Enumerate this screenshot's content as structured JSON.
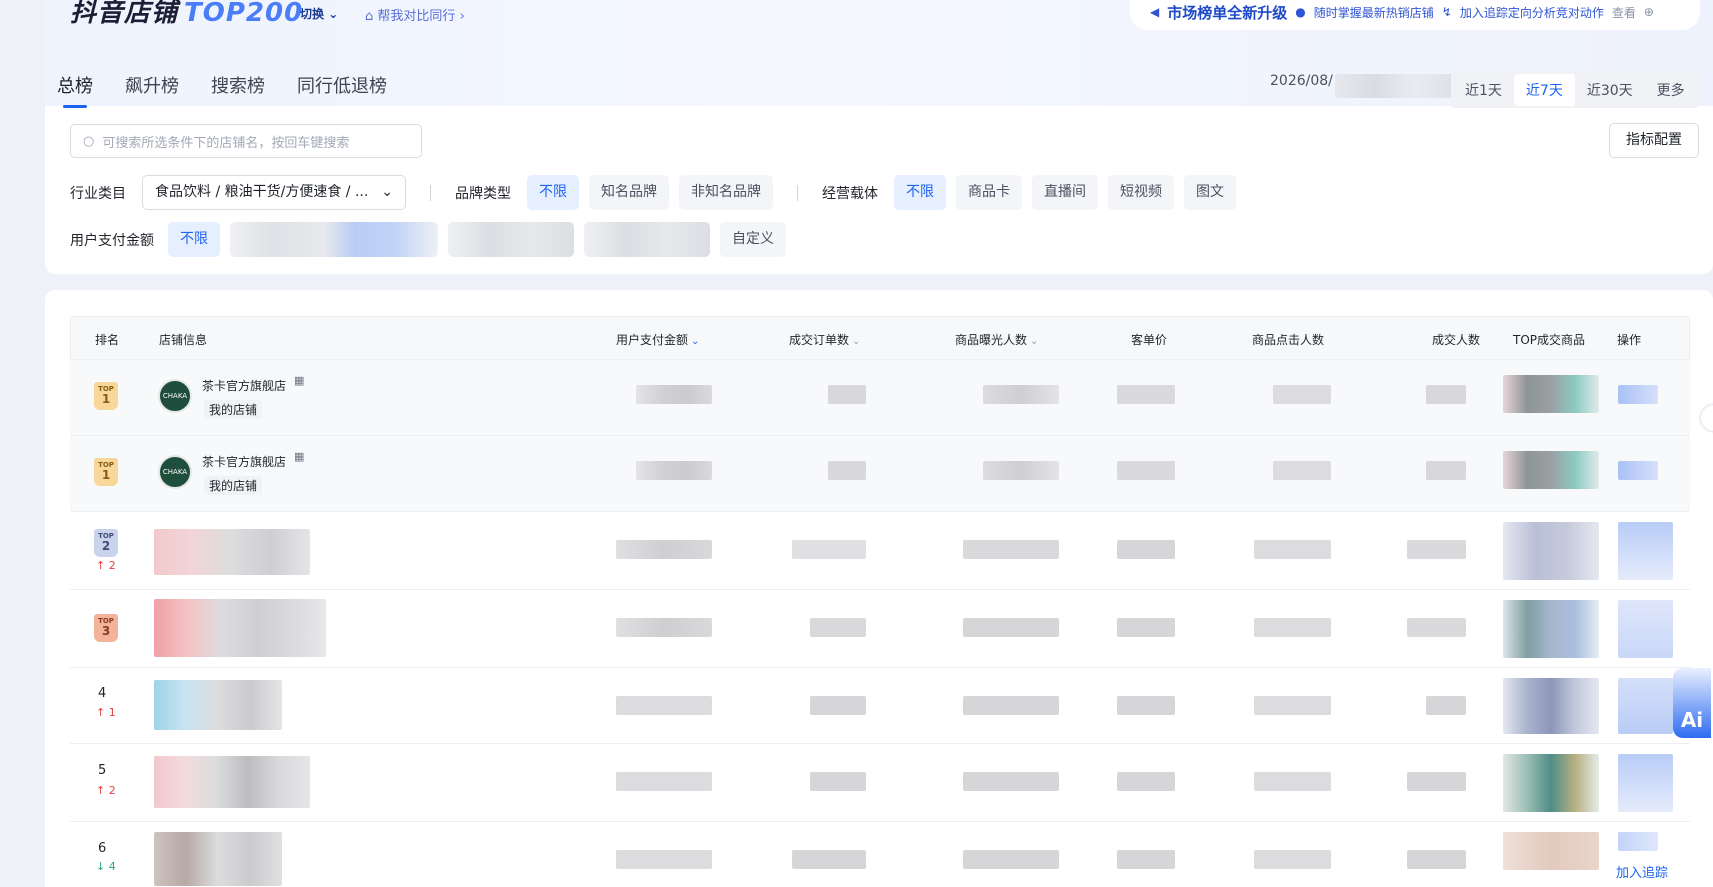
{
  "header": {
    "logo_text": "抖音店铺",
    "logo_top": "TOP200",
    "switch_label": "切换",
    "compare_label": "帮我对比同行",
    "banner_title": "市场榜单全新升级",
    "banner_text1": "随时掌握最新热销店铺",
    "banner_text2": "加入追踪定向分析竞对动作",
    "banner_link": "查看"
  },
  "tabs": [
    "总榜",
    "飙升榜",
    "搜索榜",
    "同行低退榜"
  ],
  "date": {
    "prefix": "2026/08/",
    "ranges": [
      "近1天",
      "近7天",
      "近30天",
      "更多"
    ],
    "active_range": "近7天"
  },
  "search": {
    "placeholder": "可搜索所选条件下的店铺名，按回车键搜索"
  },
  "config_button": "指标配置",
  "filters": {
    "industry_label": "行业类目",
    "industry_value": "食品饮料 / 粮油干货/方便速食 / ...",
    "brand_label": "品牌类型",
    "brand_options": [
      "不限",
      "知名品牌",
      "非知名品牌"
    ],
    "carrier_label": "经营载体",
    "carrier_options": [
      "不限",
      "商品卡",
      "直播间",
      "短视频",
      "图文"
    ],
    "pay_label": "用户支付金额",
    "pay_selected": "不限",
    "pay_custom": "自定义"
  },
  "table": {
    "columns": [
      "排名",
      "店铺信息",
      "用户支付金额",
      "成交订单数",
      "商品曝光人数",
      "客单价",
      "商品点击人数",
      "成交人数",
      "TOP成交商品",
      "操作"
    ],
    "rows": [
      {
        "rank": "1",
        "badge": "TOP",
        "shop": "茶卡官方旗舰店",
        "tag": "我的店铺",
        "avatar_text": "CHAKA"
      },
      {
        "rank": "1",
        "badge": "TOP",
        "shop": "茶卡官方旗舰店",
        "tag": "我的店铺",
        "avatar_text": "CHAKA"
      },
      {
        "rank": "2",
        "badge": "TOP",
        "delta": "2",
        "dir": "up"
      },
      {
        "rank": "3",
        "badge": "TOP"
      },
      {
        "rank": "4",
        "delta": "1",
        "dir": "up"
      },
      {
        "rank": "5",
        "delta": "2",
        "dir": "up"
      },
      {
        "rank": "6",
        "delta": "4",
        "dir": "down",
        "op": "加入追踪"
      }
    ]
  },
  "ai_label": "Ai",
  "colors": {
    "accent": "#1e63f0",
    "up": "#e04343",
    "down": "#2ea672"
  }
}
